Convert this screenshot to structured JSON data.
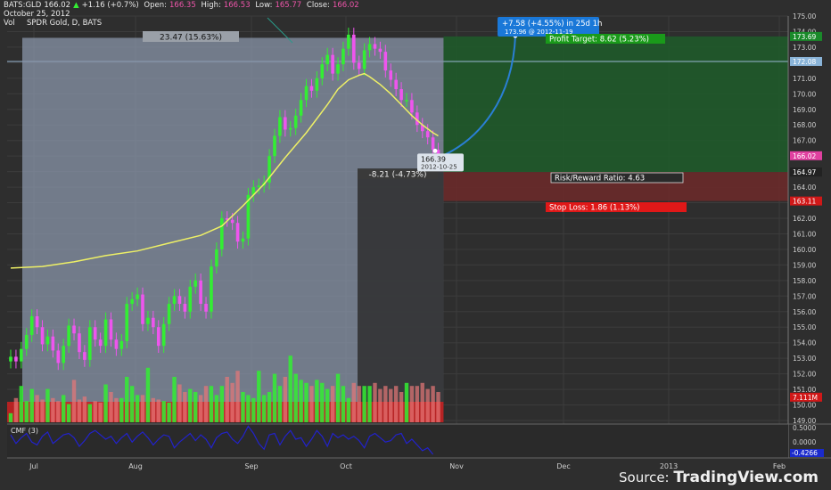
{
  "header": {
    "symbol": "BATS:GLD",
    "last": "166.02",
    "change": "+1.16 (+0.7%)",
    "open_label": "Open:",
    "open": "166.35",
    "high_label": "High:",
    "high": "166.53",
    "low_label": "Low:",
    "low": "165.77",
    "close_label": "Close:",
    "close": "166.02",
    "date": "October 25, 2012",
    "vol_label": "Vol",
    "series_title": "SPDR Gold, D, BATS"
  },
  "colors": {
    "up": "#33ee33",
    "down": "#ee55ee",
    "ma": "#eef066",
    "background": "#2e2e2e",
    "range_box": "#8a96aa",
    "target_zone": "#1f5a2a",
    "stop_zone": "#6a2a2a",
    "projection": "#2a7fd4",
    "cmf": "#2222cc"
  },
  "chart_data": {
    "type": "candlestick",
    "title": "SPDR Gold, D, BATS",
    "x_axis": {
      "ticks": [
        "Jul",
        "Aug",
        "Sep",
        "Oct",
        "Nov",
        "Dec",
        "2013",
        "Feb"
      ]
    },
    "y_axis": {
      "min": 149.0,
      "max": 175.0,
      "step": 1,
      "ticks": [
        "149.00",
        "150.00",
        "151.00",
        "152.00",
        "153.00",
        "154.00",
        "155.00",
        "156.00",
        "157.00",
        "158.00",
        "159.00",
        "160.00",
        "161.00",
        "162.00",
        "163.00",
        "164.00",
        "165.00",
        "166.00",
        "167.00",
        "168.00",
        "169.00",
        "170.00",
        "171.00",
        "172.00",
        "173.00",
        "174.00",
        "175.00"
      ]
    },
    "price_badges": [
      {
        "label": "173.69",
        "value": 173.69,
        "color": "#1a8a2a"
      },
      {
        "label": "172.08",
        "value": 172.08,
        "color": "#8ab4d8"
      },
      {
        "label": "166.02",
        "value": 166.02,
        "color": "#e040a0"
      },
      {
        "label": "164.97",
        "value": 164.97,
        "color": "#222222"
      },
      {
        "label": "163.11",
        "value": 163.11,
        "color": "#d01818"
      },
      {
        "label": "7.111M",
        "value": 150.5,
        "color": "#d01818"
      }
    ],
    "closes": [
      153.1,
      152.8,
      153.6,
      154.5,
      155.7,
      155.0,
      153.9,
      154.4,
      153.5,
      152.7,
      153.8,
      155.1,
      154.6,
      153.4,
      152.9,
      155.0,
      154.2,
      153.8,
      155.5,
      154.2,
      153.6,
      154.1,
      156.5,
      156.8,
      157.1,
      155.2,
      155.6,
      155.0,
      153.8,
      155.2,
      156.5,
      157.0,
      156.5,
      156.0,
      157.6,
      158.0,
      156.5,
      156.0,
      158.9,
      160.0,
      162.0,
      161.9,
      161.7,
      160.5,
      160.7,
      163.5,
      164.0,
      164.1,
      164.3,
      166.0,
      167.3,
      168.5,
      167.7,
      167.8,
      168.6,
      169.6,
      170.5,
      170.2,
      171.0,
      171.9,
      172.5,
      171.3,
      171.9,
      172.9,
      173.8,
      172.0,
      171.6,
      172.8,
      173.2,
      172.9,
      172.7,
      171.5,
      170.9,
      170.3,
      169.6,
      169.6,
      168.8,
      168.0,
      167.6,
      167.2,
      166.4,
      166.0
    ],
    "moving_average": {
      "label": "",
      "values": [
        [
          0,
          158.8
        ],
        [
          6,
          158.9
        ],
        [
          12,
          159.2
        ],
        [
          18,
          159.6
        ],
        [
          24,
          159.9
        ],
        [
          30,
          160.4
        ],
        [
          36,
          160.9
        ],
        [
          40,
          161.5
        ],
        [
          44,
          162.8
        ],
        [
          48,
          164.2
        ],
        [
          52,
          165.9
        ],
        [
          56,
          167.5
        ],
        [
          60,
          169.3
        ],
        [
          62,
          170.3
        ],
        [
          64,
          170.9
        ],
        [
          66,
          171.2
        ],
        [
          67,
          171.3
        ],
        [
          68,
          171.1
        ],
        [
          70,
          170.6
        ],
        [
          72,
          170.0
        ],
        [
          74,
          169.3
        ],
        [
          76,
          168.6
        ],
        [
          78,
          168.0
        ],
        [
          80,
          167.5
        ],
        [
          81,
          167.3
        ]
      ]
    },
    "volume": [
      0.6,
      1.6,
      2.4,
      1.4,
      2.2,
      1.8,
      1.5,
      2.2,
      1.6,
      1.4,
      1.8,
      1.2,
      2.8,
      1.5,
      1.7,
      1.2,
      1.4,
      1.3,
      2.5,
      2.0,
      1.6,
      1.6,
      3.0,
      2.4,
      1.8,
      1.8,
      3.6,
      1.6,
      1.5,
      1.4,
      1.3,
      3.0,
      2.5,
      2.0,
      2.2,
      2.0,
      1.8,
      2.4,
      2.4,
      1.8,
      2.4,
      3.0,
      2.6,
      3.4,
      2.0,
      1.8,
      1.6,
      3.4,
      1.8,
      2.0,
      3.2,
      2.4,
      3.0,
      4.4,
      3.2,
      2.8,
      2.6,
      2.4,
      2.8,
      2.6,
      2.2,
      2.4,
      3.2,
      2.4,
      1.6,
      2.6,
      2.4,
      2.4,
      2.4,
      2.6,
      2.2,
      2.4,
      2.2,
      2.4,
      2.0,
      2.6,
      2.4,
      2.4,
      2.6,
      2.2,
      2.4,
      2.0
    ],
    "cmf": {
      "label": "CMF (3)",
      "range": [
        -0.4266,
        0.5
      ],
      "ticks": [
        "0.5000",
        "0.0000"
      ],
      "last_label": "-0.4266",
      "values": [
        0.25,
        -0.05,
        0.15,
        0.3,
        0.0,
        -0.1,
        0.2,
        0.35,
        -0.05,
        0.1,
        0.25,
        0.3,
        0.15,
        -0.15,
        0.05,
        0.3,
        0.4,
        0.25,
        0.1,
        0.2,
        -0.05,
        0.15,
        0.3,
        0.0,
        0.2,
        0.35,
        0.15,
        -0.1,
        0.1,
        0.25,
        0.2,
        -0.2,
        0.0,
        0.15,
        0.3,
        0.05,
        0.25,
        0.1,
        -0.2,
        0.15,
        0.3,
        0.35,
        0.1,
        -0.05,
        0.2,
        0.55,
        0.3,
        -0.05,
        -0.25,
        0.25,
        0.3,
        -0.1,
        0.2,
        0.4,
        0.1,
        0.15,
        -0.15,
        0.1,
        0.4,
        0.2,
        -0.15,
        0.3,
        0.15,
        0.25,
        0.1,
        0.2,
        0.05,
        -0.2,
        0.2,
        0.3,
        0.15,
        0.0,
        0.05,
        0.25,
        0.3,
        -0.05,
        0.1,
        -0.1,
        -0.3,
        -0.2,
        -0.4266
      ]
    },
    "annotations": {
      "range_label": "23.47 (15.63%)",
      "drop_label": "-8.21 (-4.73%)",
      "projection_label": "+7.58 (+4.55%) in 25d 1h",
      "projection_sub": "173.96 @ 2012-11-19",
      "entry_price": "166.39",
      "entry_date": "2012-10-25",
      "profit_target": "Profit Target: 8.62 (5.23%)",
      "risk_reward": "Risk/Reward Ratio: 4.63",
      "stop_loss": "Stop Loss: 1.86 (1.13%)",
      "target_price": 173.69,
      "entry": 164.97,
      "stop": 163.11,
      "entry_value": 166.39,
      "projection_value": 173.96,
      "range_high": 173.6,
      "range_low": 149.0,
      "drop_level": 165.2
    }
  },
  "source": {
    "prefix": "Source: ",
    "brand": "TradingView.com"
  }
}
